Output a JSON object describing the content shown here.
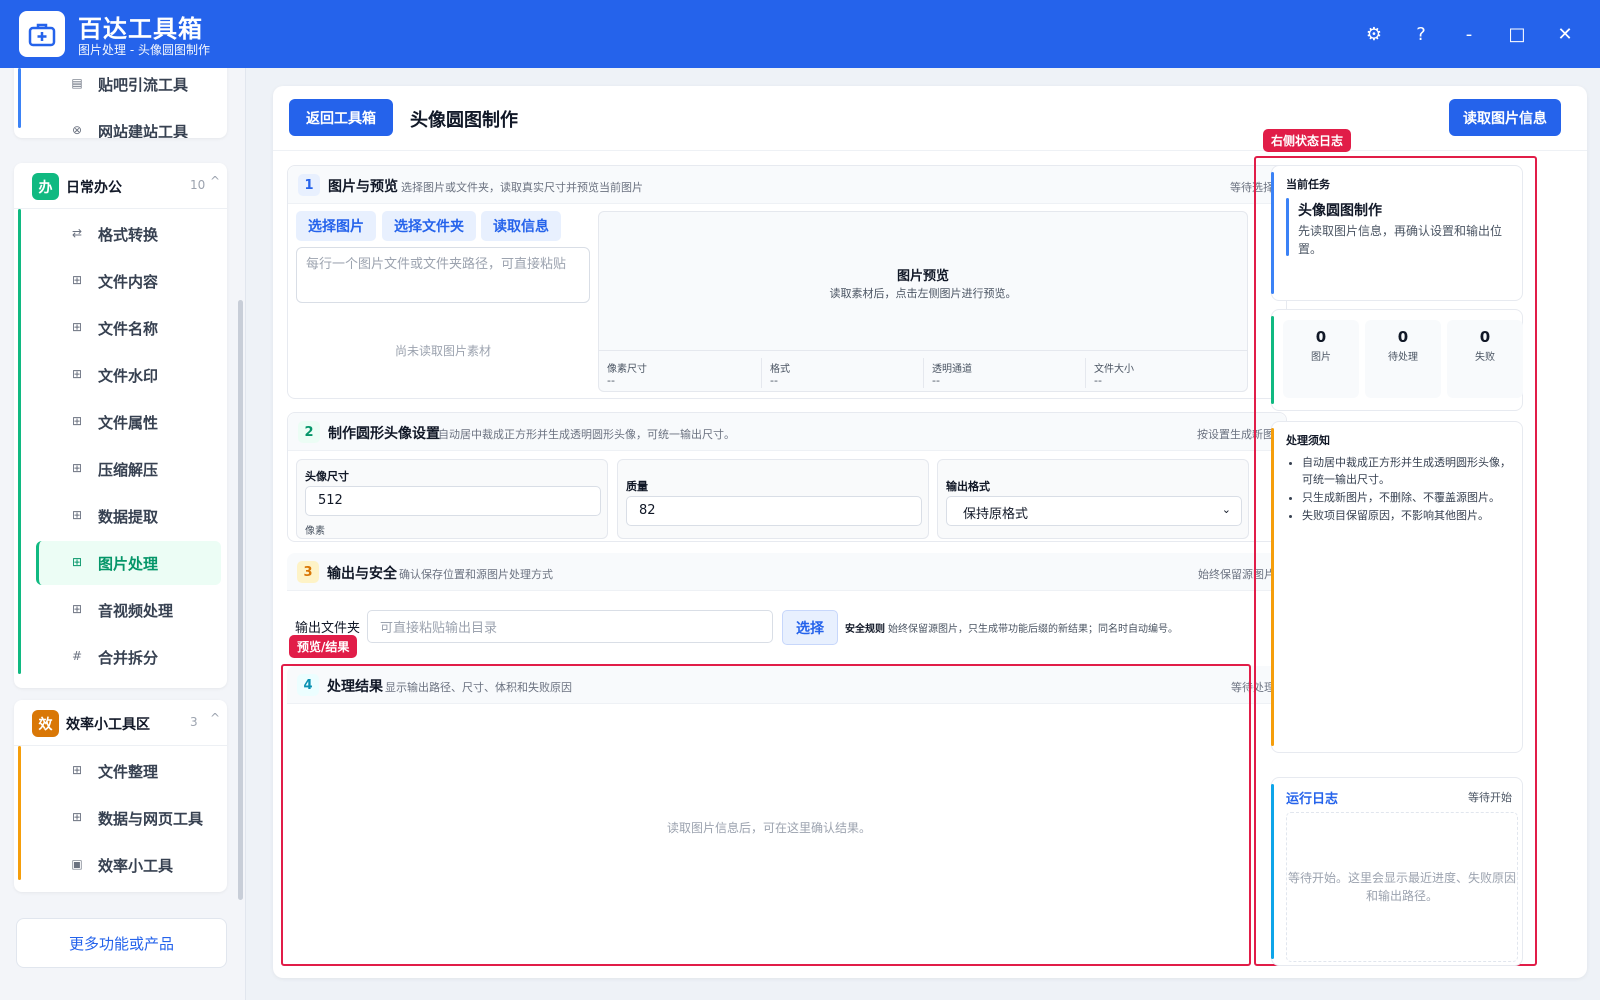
{
  "app": {
    "title": "百达工具箱",
    "subtitle": "图片处理 - 头像圆图制作",
    "brand_color": "#2563eb"
  },
  "window_controls": [
    {
      "name": "settings-icon",
      "glyph": "⚙"
    },
    {
      "name": "help-icon",
      "glyph": "?"
    },
    {
      "name": "minimize-icon",
      "glyph": "-"
    },
    {
      "name": "maximize-icon",
      "glyph": "□"
    },
    {
      "name": "close-icon",
      "glyph": "✕"
    }
  ],
  "sidebar": {
    "top_items": [
      {
        "label": "贴吧引流工具",
        "icon": "list-icon"
      },
      {
        "label": "网站建站工具",
        "icon": "globe-icon"
      }
    ],
    "groups": [
      {
        "badge": "办",
        "badge_color": "#10b981",
        "title": "日常办公",
        "count": "10",
        "caret": "^",
        "items": [
          {
            "label": "格式转换",
            "icon": "swap-icon",
            "glyph": "⇄"
          },
          {
            "label": "文件内容",
            "icon": "grid-icon",
            "glyph": "⊞"
          },
          {
            "label": "文件名称",
            "icon": "grid-icon",
            "glyph": "⊞"
          },
          {
            "label": "文件水印",
            "icon": "grid-icon",
            "glyph": "⊞"
          },
          {
            "label": "文件属性",
            "icon": "grid-icon",
            "glyph": "⊞"
          },
          {
            "label": "压缩解压",
            "icon": "grid-icon",
            "glyph": "⊞"
          },
          {
            "label": "数据提取",
            "icon": "grid-icon",
            "glyph": "⊞"
          },
          {
            "label": "图片处理",
            "icon": "grid-icon",
            "glyph": "⊞",
            "active": true
          },
          {
            "label": "音视频处理",
            "icon": "grid-icon",
            "glyph": "⊞"
          },
          {
            "label": "合并拆分",
            "icon": "hash-icon",
            "glyph": "#"
          }
        ]
      },
      {
        "badge": "效",
        "badge_color": "#d97706",
        "title": "效率小工具区",
        "count": "3",
        "caret": "^",
        "items": [
          {
            "label": "文件整理",
            "icon": "grid-icon",
            "glyph": "⊞"
          },
          {
            "label": "数据与网页工具",
            "icon": "grid-icon",
            "glyph": "⊞"
          },
          {
            "label": "效率小工具",
            "icon": "box-icon",
            "glyph": "▣"
          }
        ]
      }
    ],
    "more_button": "更多功能或产品"
  },
  "main": {
    "back_button": "返回工具箱",
    "page_title": "头像圆图制作",
    "read_info_button": "读取图片信息",
    "sections": {
      "s1": {
        "num": "1",
        "title": "图片与预览",
        "desc": "选择图片或文件夹，读取真实尺寸并预览当前图片",
        "status": "等待选择",
        "buttons": [
          "选择图片",
          "选择文件夹",
          "读取信息"
        ],
        "path_placeholder": "每行一个图片文件或文件夹路径，可直接粘贴",
        "empty_text": "尚未读取图片素材",
        "preview_title": "图片预览",
        "preview_hint": "读取素材后，点击左侧图片进行预览。",
        "meta": [
          {
            "key": "像素尺寸",
            "value": "--"
          },
          {
            "key": "格式",
            "value": "--"
          },
          {
            "key": "透明通道",
            "value": "--"
          },
          {
            "key": "文件大小",
            "value": "--"
          }
        ]
      },
      "s2": {
        "num": "2",
        "title": "制作圆形头像设置",
        "desc": "自动居中裁成正方形并生成透明圆形头像，可统一输出尺寸。",
        "status": "按设置生成新图",
        "size_label": "头像尺寸",
        "size_value": "512",
        "size_unit": "像素",
        "quality_label": "质量",
        "quality_value": "82",
        "format_label": "输出格式",
        "format_value": "保持原格式"
      },
      "s3": {
        "num": "3",
        "title": "输出与安全",
        "desc": "确认保存位置和源图片处理方式",
        "status": "始终保留源图片",
        "output_label": "输出文件夹",
        "output_placeholder": "可直接粘贴输出目录",
        "choose_button": "选择",
        "safety_label": "安全规则",
        "safety_text": "始终保留源图片，只生成带功能后缀的新结果；同名时自动编号。"
      },
      "s4": {
        "num": "4",
        "title": "处理结果",
        "desc": "显示输出路径、尺寸、体积和失败原因",
        "status": "等待处理",
        "empty_text": "读取图片信息后，可在这里确认结果。"
      }
    },
    "annotations": {
      "preview_tag": "预览/结果",
      "right_tag": "右侧状态日志",
      "color": "#e11d48"
    }
  },
  "right_panel": {
    "task_label": "当前任务",
    "task_title": "头像圆图制作",
    "task_desc": "先读取图片信息，再确认设置和输出位置。",
    "stats": [
      {
        "value": "0",
        "label": "图片"
      },
      {
        "value": "0",
        "label": "待处理"
      },
      {
        "value": "0",
        "label": "失败"
      }
    ],
    "notes_title": "处理须知",
    "notes": [
      "自动居中裁成正方形并生成透明圆形头像，可统一输出尺寸。",
      "只生成新图片，不删除、不覆盖源图片。",
      "失败项目保留原因，不影响其他图片。"
    ],
    "log_title": "运行日志",
    "log_status": "等待开始",
    "log_empty": "等待开始。这里会显示最近进度、失败原因和输出路径。"
  }
}
